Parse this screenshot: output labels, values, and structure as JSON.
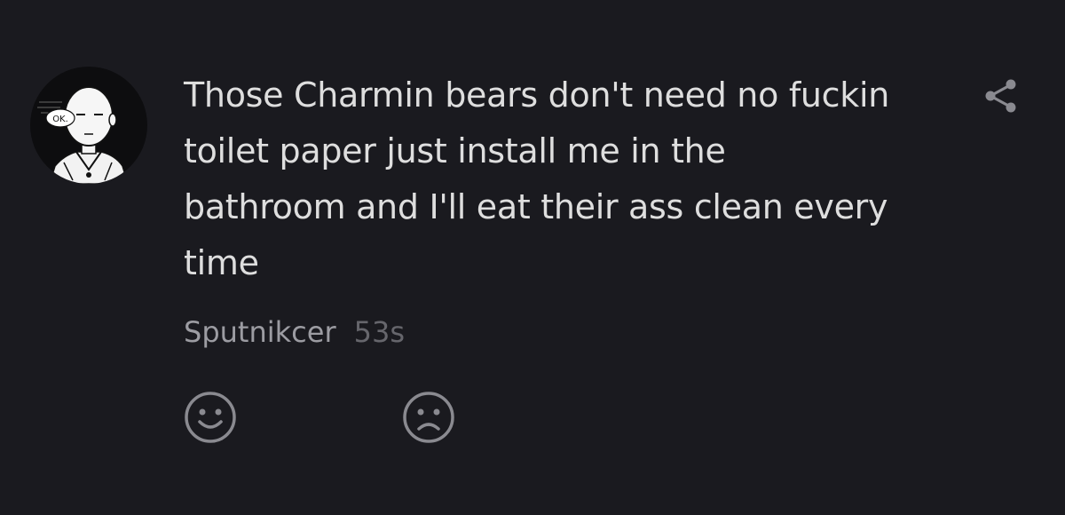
{
  "comment": {
    "avatar": {
      "icon": "bald-hero-avatar-icon",
      "badge_text": "OK."
    },
    "text": "Those Charmin bears don't need no fuckin toilet paper just install me in the bathroom and I'll eat their ass clean every time",
    "author": "Sputnikcer",
    "timestamp": "53s",
    "share_icon": "share-icon",
    "reactions": {
      "like_icon": "smiley-face-icon",
      "dislike_icon": "frowny-face-icon"
    }
  },
  "colors": {
    "background": "#1a1a1f",
    "text": "#dedede",
    "author": "#9c9ca2",
    "timestamp": "#66666c",
    "icon": "#8a8a90"
  }
}
